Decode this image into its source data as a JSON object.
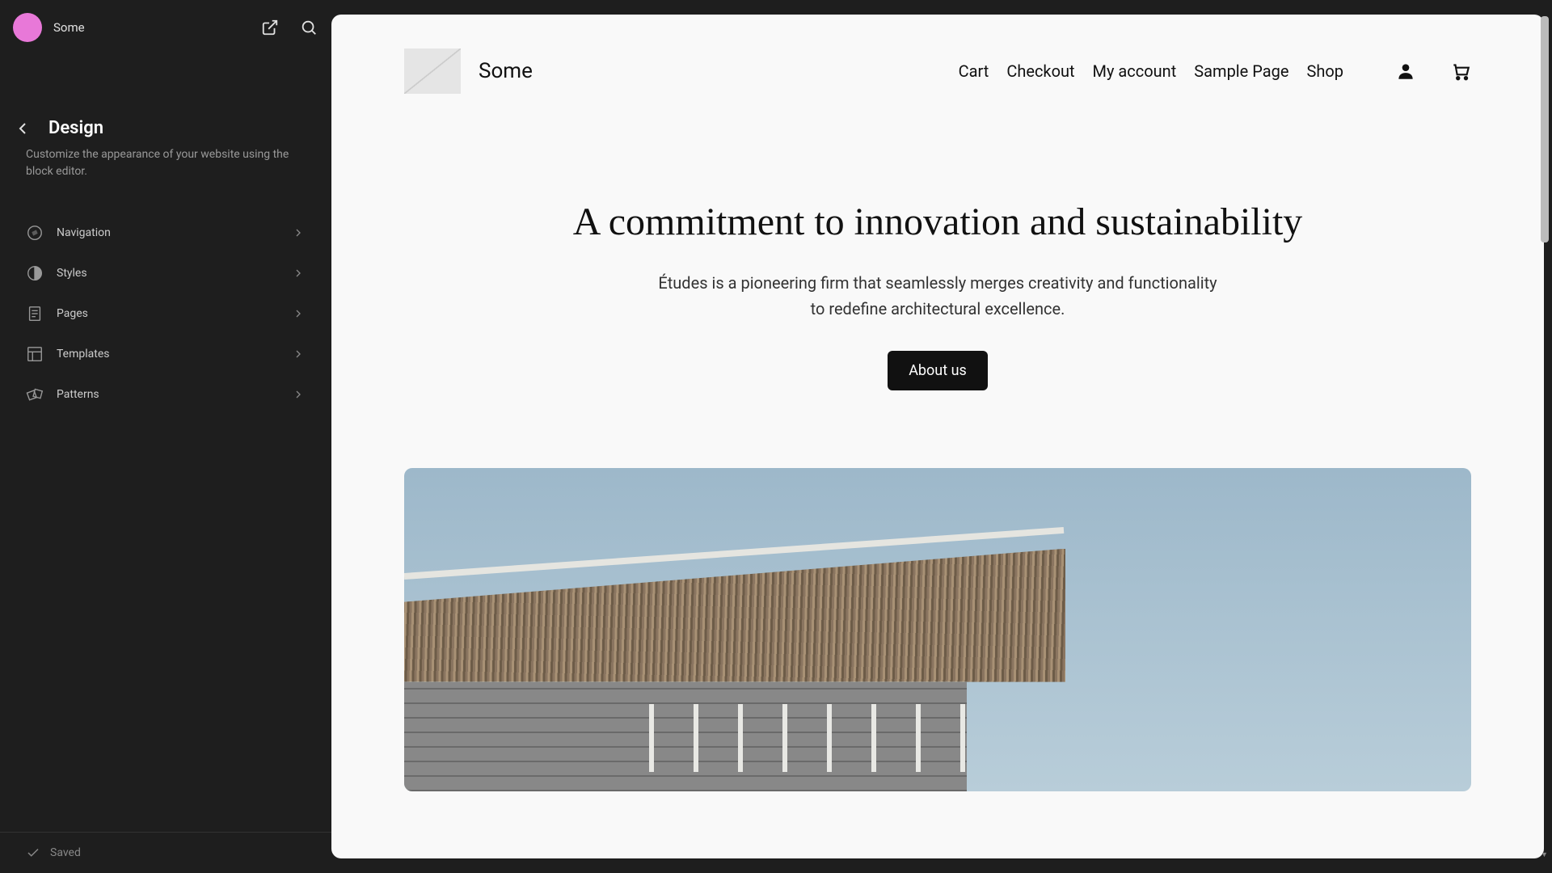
{
  "sidebar": {
    "site_name": "Some",
    "panel_title": "Design",
    "panel_desc": "Customize the appearance of your website using the block editor.",
    "items": [
      {
        "label": "Navigation"
      },
      {
        "label": "Styles"
      },
      {
        "label": "Pages"
      },
      {
        "label": "Templates"
      },
      {
        "label": "Patterns"
      }
    ],
    "footer_status": "Saved"
  },
  "preview": {
    "site_title": "Some",
    "nav": [
      {
        "label": "Cart"
      },
      {
        "label": "Checkout"
      },
      {
        "label": "My account"
      },
      {
        "label": "Sample Page"
      },
      {
        "label": "Shop"
      }
    ],
    "hero_title": "A commitment to innovation and sustainability",
    "hero_subtitle": "Études is a pioneering firm that seamlessly merges creativity and functionality to redefine architectural excellence.",
    "hero_button": "About us"
  }
}
